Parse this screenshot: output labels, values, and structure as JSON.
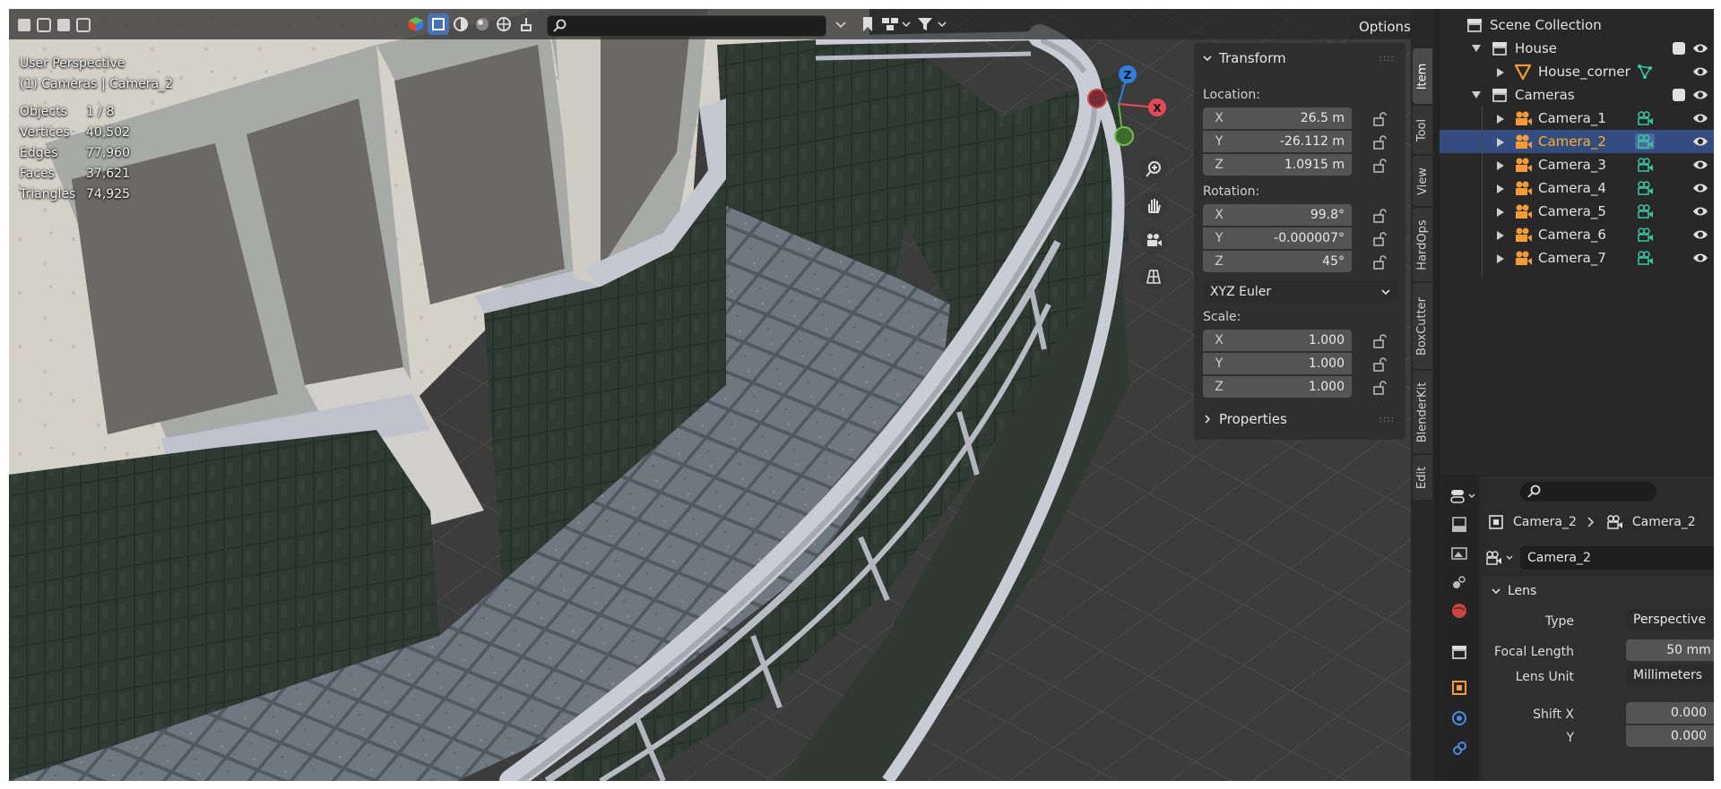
{
  "viewport": {
    "perspective": "User Perspective",
    "collection_info": "(1) Cameras | Camera_2",
    "stats": [
      {
        "label": "Objects",
        "value": "1 / 8"
      },
      {
        "label": "Vertices",
        "value": "40,502"
      },
      {
        "label": "Edges",
        "value": "77,960"
      },
      {
        "label": "Faces",
        "value": "37,621"
      },
      {
        "label": "Triangles",
        "value": "74,925"
      }
    ],
    "options_label": "Options",
    "gizmo": {
      "z": "Z",
      "x": "X"
    }
  },
  "npanel": {
    "transform_header": "Transform",
    "location_label": "Location:",
    "location": [
      {
        "axis": "X",
        "value": "26.5 m"
      },
      {
        "axis": "Y",
        "value": "-26.112 m"
      },
      {
        "axis": "Z",
        "value": "1.0915 m"
      }
    ],
    "rotation_label": "Rotation:",
    "rotation": [
      {
        "axis": "X",
        "value": "99.8°"
      },
      {
        "axis": "Y",
        "value": "-0.000007°"
      },
      {
        "axis": "Z",
        "value": "45°"
      }
    ],
    "rotation_mode": "XYZ Euler",
    "scale_label": "Scale:",
    "scale": [
      {
        "axis": "X",
        "value": "1.000"
      },
      {
        "axis": "Y",
        "value": "1.000"
      },
      {
        "axis": "Z",
        "value": "1.000"
      }
    ],
    "properties_header": "Properties"
  },
  "sidebar_tabs": [
    "Item",
    "Tool",
    "View",
    "HardOps",
    "BoxCutter",
    "BlenderKit",
    "Edit"
  ],
  "outliner": {
    "root": "Scene Collection",
    "rows": [
      {
        "label": "House"
      },
      {
        "label": "House_corner"
      },
      {
        "label": "Cameras"
      },
      {
        "label": "Camera_1"
      },
      {
        "label": "Camera_2"
      },
      {
        "label": "Camera_3"
      },
      {
        "label": "Camera_4"
      },
      {
        "label": "Camera_5"
      },
      {
        "label": "Camera_6"
      },
      {
        "label": "Camera_7"
      }
    ]
  },
  "properties": {
    "breadcrumb_object": "Camera_2",
    "breadcrumb_data": "Camera_2",
    "data_name": "Camera_2",
    "lens_header": "Lens",
    "type_label": "Type",
    "type_value": "Perspective",
    "focal_label": "Focal Length",
    "focal_value": "50 mm",
    "unit_label": "Lens Unit",
    "unit_value": "Millimeters",
    "shiftx_label": "Shift X",
    "shiftx_value": "0.000",
    "shifty_label": "Y",
    "shifty_value": "0.000"
  }
}
